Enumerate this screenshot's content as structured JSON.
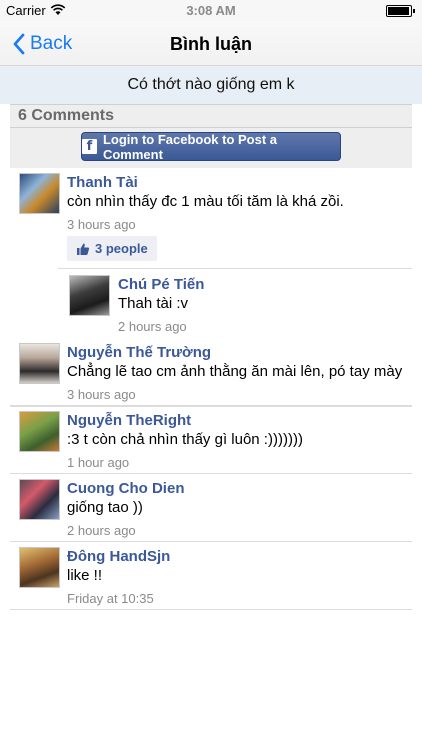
{
  "status_bar": {
    "carrier": "Carrier",
    "time": "3:08 AM"
  },
  "nav": {
    "back_label": "Back",
    "title": "Bình luận"
  },
  "post_title": "Có thớt nào giống em k",
  "comments_count_label": "6 Comments",
  "login_button_label": "Login to Facebook to Post a Comment",
  "comments": [
    {
      "name": "Thanh Tài",
      "text": "còn nhìn thấy đc 1 màu tối tăm là khá zồi.",
      "time": "3 hours ago",
      "likes_label": "3 people",
      "replies": [
        {
          "name": "Chú Pé Tiến",
          "text": "Thah tài :v",
          "time": "2 hours ago"
        }
      ]
    },
    {
      "name": "Nguyễn Thế Trường",
      "text": "Chẳng lẽ tao cm ảnh thằng ăn mài lên, pó tay mày",
      "time": "3 hours ago"
    },
    {
      "name": "Nguyễn TheRight",
      "text": ":3 t còn chả nhìn thấy gì luôn :)))))))",
      "time": "1 hour ago"
    },
    {
      "name": "Cuong Cho Dien",
      "text": "giống tao ))",
      "time": "2 hours ago"
    },
    {
      "name": "Đông HandSjn",
      "text": "like !!",
      "time": "Friday at 10:35"
    }
  ],
  "colors": {
    "accent": "#1a7cf4",
    "facebook_blue": "#3b5998",
    "header_bg": "#e8eef6"
  }
}
